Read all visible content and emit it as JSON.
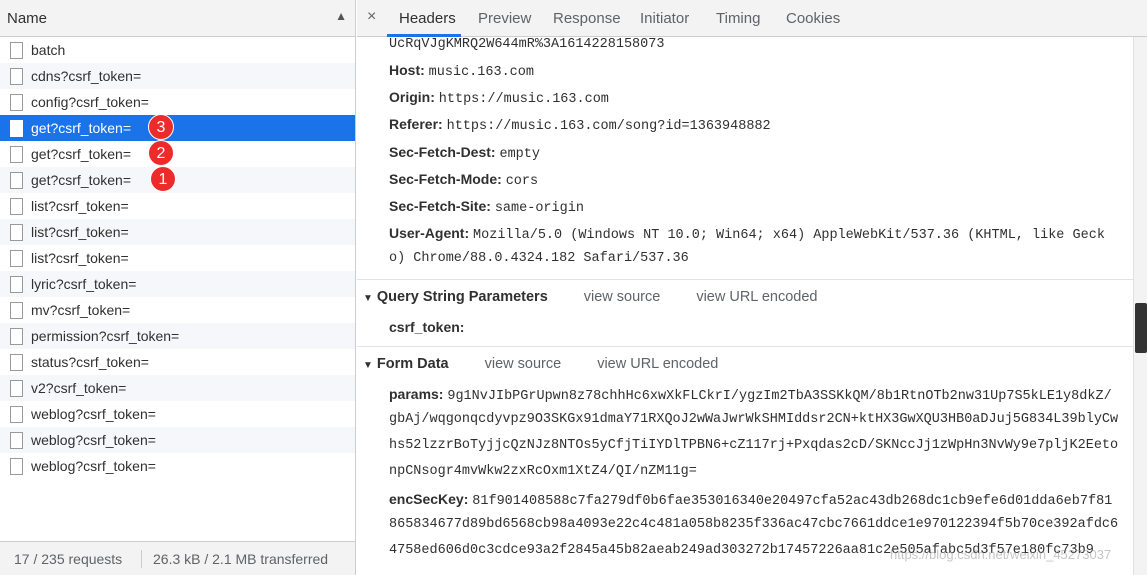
{
  "name_column": {
    "label": "Name",
    "sort_indicator": "▲"
  },
  "requests": [
    {
      "name": "batch"
    },
    {
      "name": "cdns?csrf_token="
    },
    {
      "name": "config?csrf_token="
    },
    {
      "name": "get?csrf_token=",
      "selected": true,
      "badge": "3"
    },
    {
      "name": "get?csrf_token=",
      "badge": "2"
    },
    {
      "name": "get?csrf_token=",
      "badge": "1"
    },
    {
      "name": "list?csrf_token="
    },
    {
      "name": "list?csrf_token="
    },
    {
      "name": "list?csrf_token="
    },
    {
      "name": "lyric?csrf_token="
    },
    {
      "name": "mv?csrf_token="
    },
    {
      "name": "permission?csrf_token="
    },
    {
      "name": "status?csrf_token="
    },
    {
      "name": "v2?csrf_token="
    },
    {
      "name": "weblog?csrf_token="
    },
    {
      "name": "weblog?csrf_token="
    },
    {
      "name": "weblog?csrf_token="
    }
  ],
  "status": {
    "requests": "17 / 235 requests",
    "transferred": "26.3 kB / 2.1 MB transferred"
  },
  "tabs": {
    "close": "×",
    "headers": "Headers",
    "preview": "Preview",
    "response": "Response",
    "initiator": "Initiator",
    "timing": "Timing",
    "cookies": "Cookies"
  },
  "request_headers": {
    "cookie_tail": "UcRqVJgKMRQ2W644mR%3A1614228158073",
    "host_key": "Host:",
    "host_val": "music.163.com",
    "origin_key": "Origin:",
    "origin_val": "https://music.163.com",
    "referer_key": "Referer:",
    "referer_val": "https://music.163.com/song?id=1363948882",
    "sfd_key": "Sec-Fetch-Dest:",
    "sfd_val": "empty",
    "sfm_key": "Sec-Fetch-Mode:",
    "sfm_val": "cors",
    "sfs_key": "Sec-Fetch-Site:",
    "sfs_val": "same-origin",
    "ua_key": "User-Agent:",
    "ua_val_1": "Mozilla/5.0 (Windows NT 10.0; Win64; x64) AppleWebKit/537.36 (KHTML, like Geck",
    "ua_val_2": "o) Chrome/88.0.4324.182 Safari/537.36"
  },
  "query_string": {
    "title": "Query String Parameters",
    "view_source": "view source",
    "view_url_encoded": "view URL encoded",
    "csrf_key": "csrf_token:"
  },
  "form_data": {
    "title": "Form Data",
    "view_source": "view source",
    "view_url_encoded": "view URL encoded",
    "params_key": "params:",
    "params_1": "9g1NvJIbPGrUpwn8z78chhHc6xwXkFLCkrI/ygzIm2TbA3SSKkQM/8b1RtnOTb2nw31Up7S5kLE1y8dkZ/",
    "params_2": "gbAj/wqgonqcdyvpz9O3SKGx91dmaY71RXQoJ2wWaJwrWkSHMIddsr2CN+ktHX3GwXQU3HB0aDJuj5G834L39blyCw",
    "params_3": "hs52lzzrBoTyjjcQzNJz8NTOs5yCfjTiIYDlTPBN6+cZ117rj+Pxqdas2cD/SKNccJj1zWpHn3NvWy9e7pljK2Eeto",
    "params_4": "npCNsogr4mvWkw2zxRcOxm1XtZ4/QI/nZM11g=",
    "enc_key": "encSecKey:",
    "enc_1": "81f901408588c7fa279df0b6fae353016340e20497cfa52ac43db268dc1cb9efe6d01dda6eb7f81",
    "enc_2": "865834677d89bd6568cb98a4093e22c4c481a058b8235f336ac47cbc7661ddce1e970122394f5b70ce392afdc6",
    "enc_3": "4758ed606d0c3cdce93a2f2845a45b82aeab249ad303272b17457226aa81c2e505afabc5d3f57e180fc73b9"
  },
  "watermark": "https://blog.csdn.net/weixin_45273037"
}
